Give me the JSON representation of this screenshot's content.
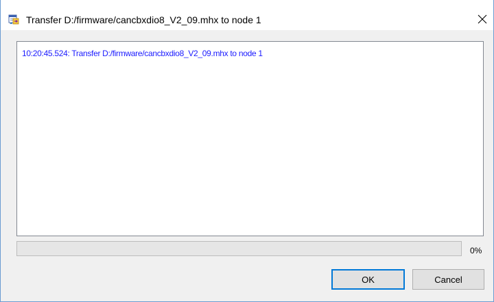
{
  "window": {
    "title": "Transfer D:/firmware/cancbxdio8_V2_09.mhx to node 1",
    "icon": "transfer-app-icon",
    "close_icon": "close-icon"
  },
  "log": {
    "lines": [
      "10:20:45.524: Transfer D:/firmware/cancbxdio8_V2_09.mhx to node 1"
    ],
    "text_color": "#1a1aff"
  },
  "progress": {
    "value_fraction": 0,
    "label": "0%",
    "fill_color": "#06b025"
  },
  "buttons": {
    "ok_label": "OK",
    "cancel_label": "Cancel"
  },
  "colors": {
    "accent": "#0078d7",
    "frame": "#6a9bd1"
  }
}
